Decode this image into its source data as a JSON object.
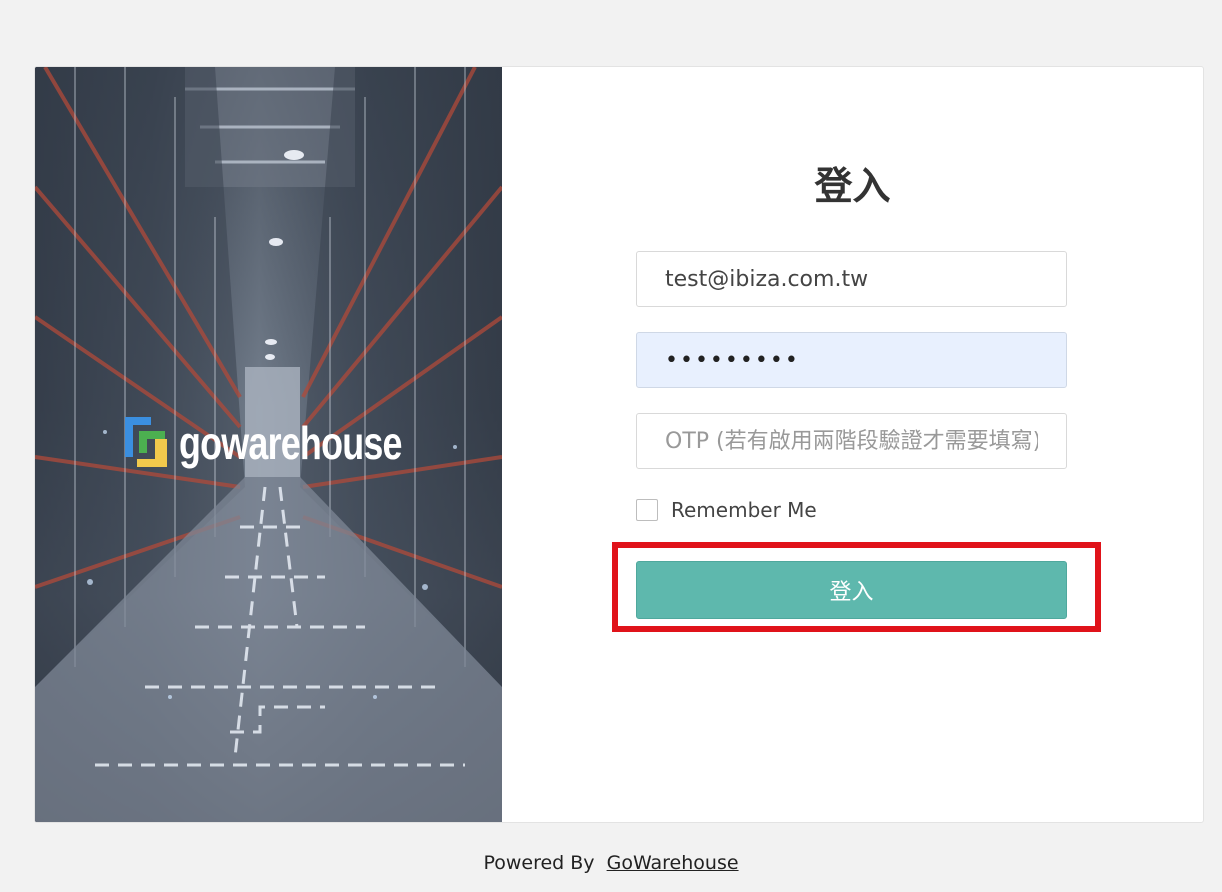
{
  "brand": {
    "logo_text": "gowarehouse",
    "colors": {
      "blue": "#3b8fe0",
      "green": "#4caf50",
      "yellow": "#f2c94c"
    }
  },
  "login": {
    "title": "登入",
    "email_value": "test@ibiza.com.tw",
    "password_value": "•••••••••",
    "otp_placeholder": "OTP (若有啟用兩階段驗證才需要填寫)",
    "remember_label": "Remember Me",
    "remember_checked": false,
    "submit_label": "登入"
  },
  "footer": {
    "powered_by": "Powered By",
    "link_text": "GoWarehouse"
  },
  "colors": {
    "button": "#5eb8ad",
    "highlight": "#e0131a",
    "page_bg": "#f2f2f2"
  }
}
